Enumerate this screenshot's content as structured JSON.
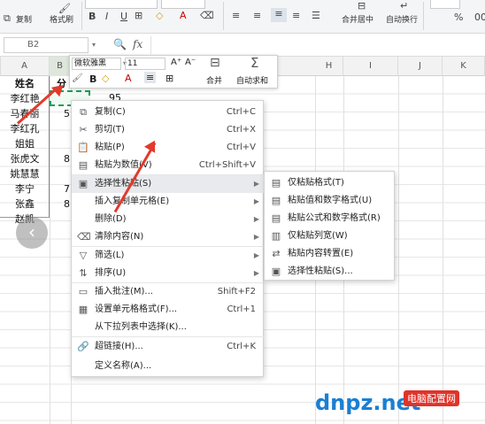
{
  "ribbon": {
    "font_name": "微软雅黑",
    "font_size": "11",
    "copy": "复制",
    "format_painter": "格式刷",
    "bold": "B",
    "italic": "I",
    "underline": "U",
    "merge_center": "合并居中",
    "wrap_text": "自动换行",
    "format_pct": "%"
  },
  "formula_bar": {
    "name_box": "B2",
    "fx": "fx"
  },
  "columns": [
    "A",
    "B",
    "C",
    "D",
    "E",
    "F",
    "G",
    "H",
    "I",
    "J",
    "K"
  ],
  "cells": {
    "a1": "姓名",
    "b1": "分",
    "names": [
      "李红艳",
      "马春丽",
      "李红孔",
      "姐姐",
      "张虎文",
      "姚慧慧",
      "李宁",
      "张鑫",
      "赵凯"
    ],
    "b_visible": [
      "5",
      "8",
      "7",
      "8"
    ],
    "d2": "95"
  },
  "mini_toolbar": {
    "font": "微软雅黑",
    "size": "11",
    "merge": "合并",
    "autosum": "自动求和",
    "grow": "A⁺",
    "shrink": "A⁻"
  },
  "context_menu": {
    "items": [
      {
        "label": "复制(C)",
        "shortcut": "Ctrl+C",
        "icon": "copy-icon"
      },
      {
        "label": "剪切(T)",
        "shortcut": "Ctrl+X",
        "icon": "scissors-icon"
      },
      {
        "label": "粘贴(P)",
        "shortcut": "Ctrl+V",
        "icon": "paste-icon"
      },
      {
        "label": "粘贴为数值(V)",
        "shortcut": "Ctrl+Shift+V",
        "icon": "paste-values-icon"
      },
      {
        "label": "选择性粘贴(S)",
        "shortcut": "",
        "icon": "paste-special-icon"
      },
      {
        "label": "插入复制单元格(E)",
        "shortcut": "",
        "icon": ""
      },
      {
        "label": "删除(D)",
        "shortcut": "",
        "icon": ""
      },
      {
        "label": "清除内容(N)",
        "shortcut": "",
        "icon": "eraser-icon"
      },
      {
        "label": "筛选(L)",
        "shortcut": "",
        "icon": "filter-icon"
      },
      {
        "label": "排序(U)",
        "shortcut": "",
        "icon": "sort-icon"
      },
      {
        "label": "插入批注(M)...",
        "shortcut": "Shift+F2",
        "icon": "comment-icon"
      },
      {
        "label": "设置单元格格式(F)...",
        "shortcut": "Ctrl+1",
        "icon": "format-cells-icon"
      },
      {
        "label": "从下拉列表中选择(K)...",
        "shortcut": "",
        "icon": ""
      },
      {
        "label": "超链接(H)...",
        "shortcut": "Ctrl+K",
        "icon": "link-icon"
      },
      {
        "label": "定义名称(A)...",
        "shortcut": "",
        "icon": ""
      }
    ]
  },
  "submenu": {
    "items": [
      {
        "label": "仅粘贴格式(T)",
        "icon": "paste-format-icon"
      },
      {
        "label": "粘贴值和数字格式(U)",
        "icon": "paste-value-number-icon"
      },
      {
        "label": "粘贴公式和数字格式(R)",
        "icon": "paste-formula-icon"
      },
      {
        "label": "仅粘贴列宽(W)",
        "icon": "paste-colwidth-icon"
      },
      {
        "label": "粘贴内容转置(E)",
        "icon": "transpose-icon"
      },
      {
        "label": "选择性粘贴(S)...",
        "icon": "paste-special-icon"
      }
    ]
  },
  "watermark": {
    "logo": "dnpz.net",
    "tag": "电脑配置网"
  },
  "colors": {
    "arrow": "#e23a2c",
    "highlight": "#e8eaed",
    "selection": "#1f9d55"
  }
}
